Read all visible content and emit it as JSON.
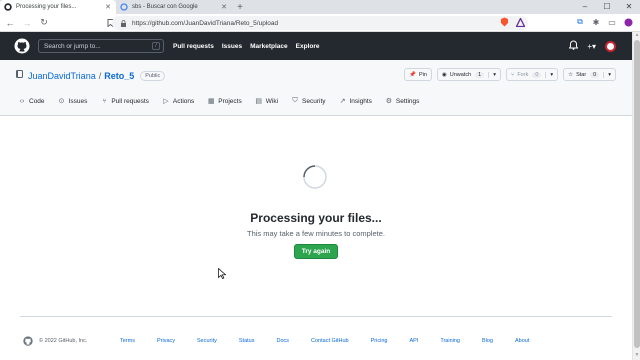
{
  "browser": {
    "tabs": [
      {
        "title": "Processing your files...",
        "active": true
      },
      {
        "title": "sbs - Buscar con Google",
        "active": false
      }
    ],
    "new_tab_label": "+",
    "url": "https://github.com/JuanDavidTriana/Reto_5/upload",
    "window_controls": [
      "–",
      "☐",
      "✕"
    ]
  },
  "header": {
    "search_placeholder": "Search or jump to...",
    "search_shortcut": "/",
    "nav": [
      "Pull requests",
      "Issues",
      "Marketplace",
      "Explore"
    ]
  },
  "repo": {
    "owner": "JuanDavidTriana",
    "separator": "/",
    "name": "Reto_5",
    "visibility": "Public",
    "buttons": {
      "pin": "Pin",
      "unwatch": "Unwatch",
      "unwatch_count": "1",
      "fork": "Fork",
      "fork_count": "0",
      "star": "Star",
      "star_count": "0"
    },
    "tabs": [
      "Code",
      "Issues",
      "Pull requests",
      "Actions",
      "Projects",
      "Wiki",
      "Security",
      "Insights",
      "Settings"
    ]
  },
  "main": {
    "title": "Processing your files...",
    "subtitle": "This may take a few minutes to complete.",
    "retry_label": "Try again"
  },
  "footer": {
    "copyright": "© 2022 GitHub, Inc.",
    "links": [
      "Terms",
      "Privacy",
      "Security",
      "Status",
      "Docs",
      "Contact GitHub",
      "Pricing",
      "API",
      "Training",
      "Blog",
      "About"
    ]
  },
  "colors": {
    "header_bg": "#24292f",
    "link": "#0969da",
    "primary_button": "#2da44e"
  }
}
